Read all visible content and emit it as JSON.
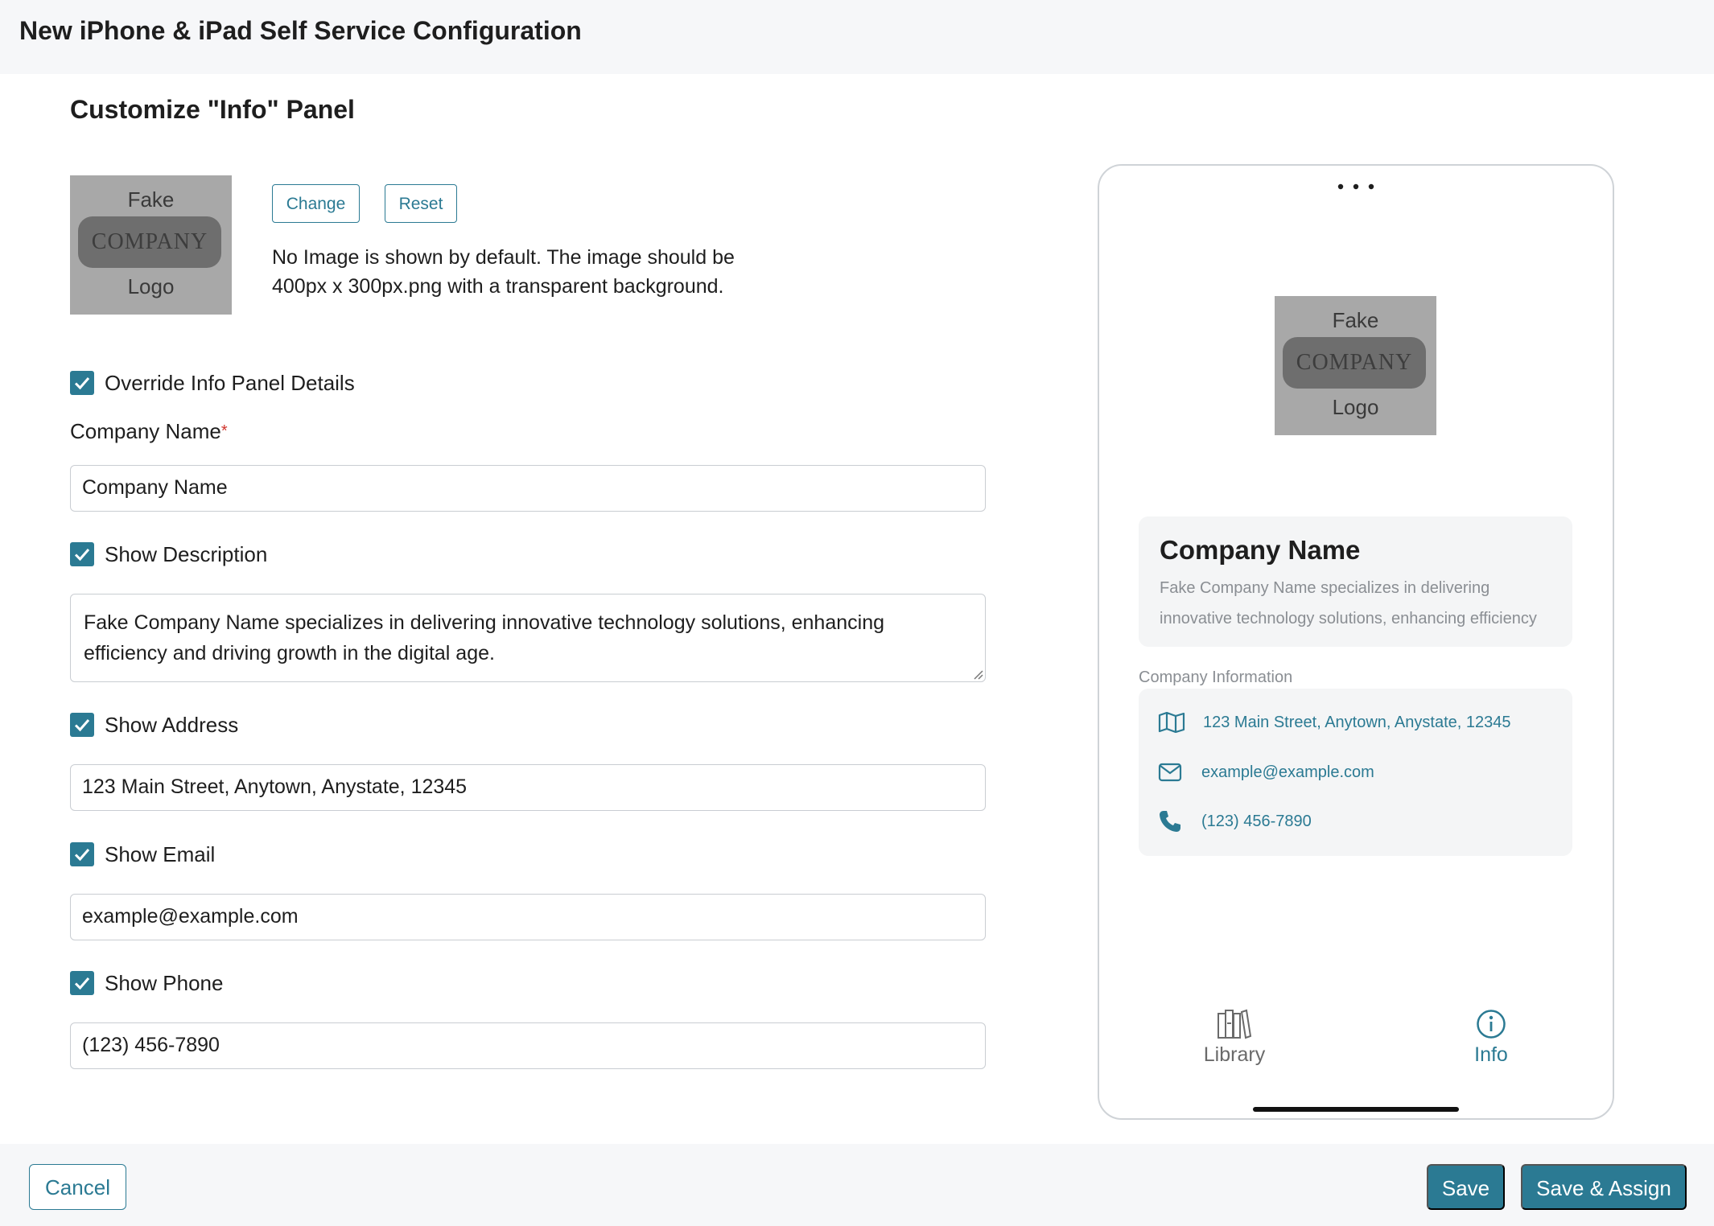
{
  "header": {
    "title": "New iPhone & iPad Self Service Configuration"
  },
  "section": {
    "title": "Customize \"Info\" Panel"
  },
  "logo": {
    "line1": "Fake",
    "line2": "COMPANY",
    "line3": "Logo"
  },
  "image_controls": {
    "change_label": "Change",
    "reset_label": "Reset",
    "hint": "No Image is shown by default. The image should be 400px x 300px.png with a transparent background."
  },
  "form": {
    "override": {
      "label": "Override Info Panel Details",
      "checked": true
    },
    "company_name": {
      "label": "Company Name",
      "required_mark": "*",
      "value": "Company Name"
    },
    "description": {
      "label": "Show Description",
      "checked": true,
      "value": "Fake Company Name specializes in delivering innovative technology solutions, enhancing efficiency and driving growth in the digital age."
    },
    "address": {
      "label": "Show Address",
      "checked": true,
      "value": "123 Main Street, Anytown, Anystate, 12345"
    },
    "email": {
      "label": "Show Email",
      "checked": true,
      "value": "example@example.com"
    },
    "phone": {
      "label": "Show Phone",
      "checked": true,
      "value": "(123) 456-7890"
    }
  },
  "preview": {
    "menu_icon": "ellipsis-icon",
    "company_name": "Company Name",
    "description": "Fake Company Name specializes in delivering innovative technology solutions, enhancing efficiency",
    "info_section_label": "Company Information",
    "address": "123 Main Street, Anytown, Anystate, 12345",
    "email": "example@example.com",
    "phone": "(123) 456-7890",
    "tabs": [
      {
        "label": "Library",
        "icon": "library-icon",
        "active": false
      },
      {
        "label": "Info",
        "icon": "info-icon",
        "active": true
      }
    ]
  },
  "footer": {
    "cancel_label": "Cancel",
    "save_label": "Save",
    "save_assign_label": "Save & Assign"
  },
  "colors": {
    "accent": "#2b7a93",
    "muted_text": "#8a8e93",
    "bar_background": "#f6f7f9",
    "required": "#d0342c"
  }
}
